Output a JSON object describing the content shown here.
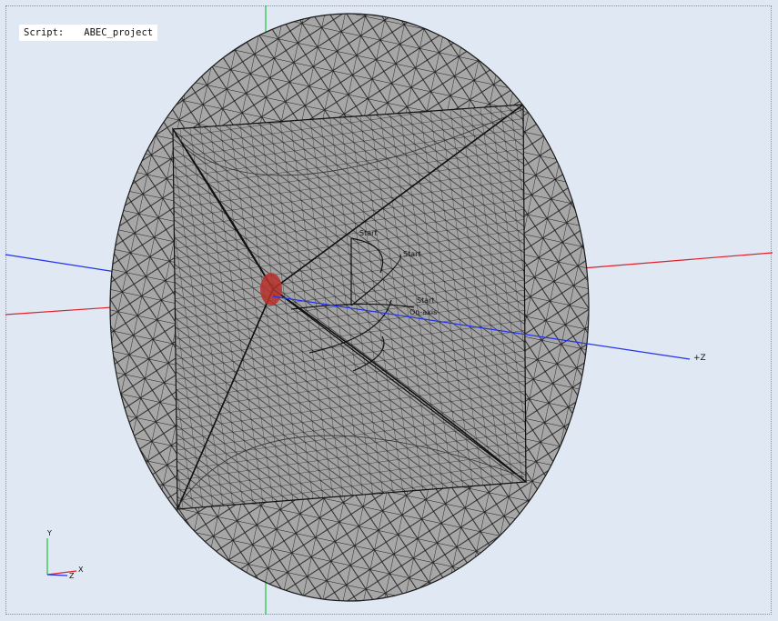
{
  "app": {
    "script_label": "Script:",
    "script_name": "ABEC_project"
  },
  "axes": {
    "z_label": "+Z",
    "triad_y": "Y",
    "triad_x": "X",
    "triad_z": "Z"
  },
  "annotations": {
    "start_top": "Start",
    "start_mid": "Start",
    "start_right": "Start",
    "on_axis": "On-axis"
  },
  "colors": {
    "background": "#dfe8f3",
    "mesh_fill": "#a7a7a7",
    "mesh_line": "#1c1c1c",
    "z_axis": "#2233ee",
    "x_axis": "#e0202a",
    "y_axis": "#20c040",
    "throat": "#b8302c"
  }
}
